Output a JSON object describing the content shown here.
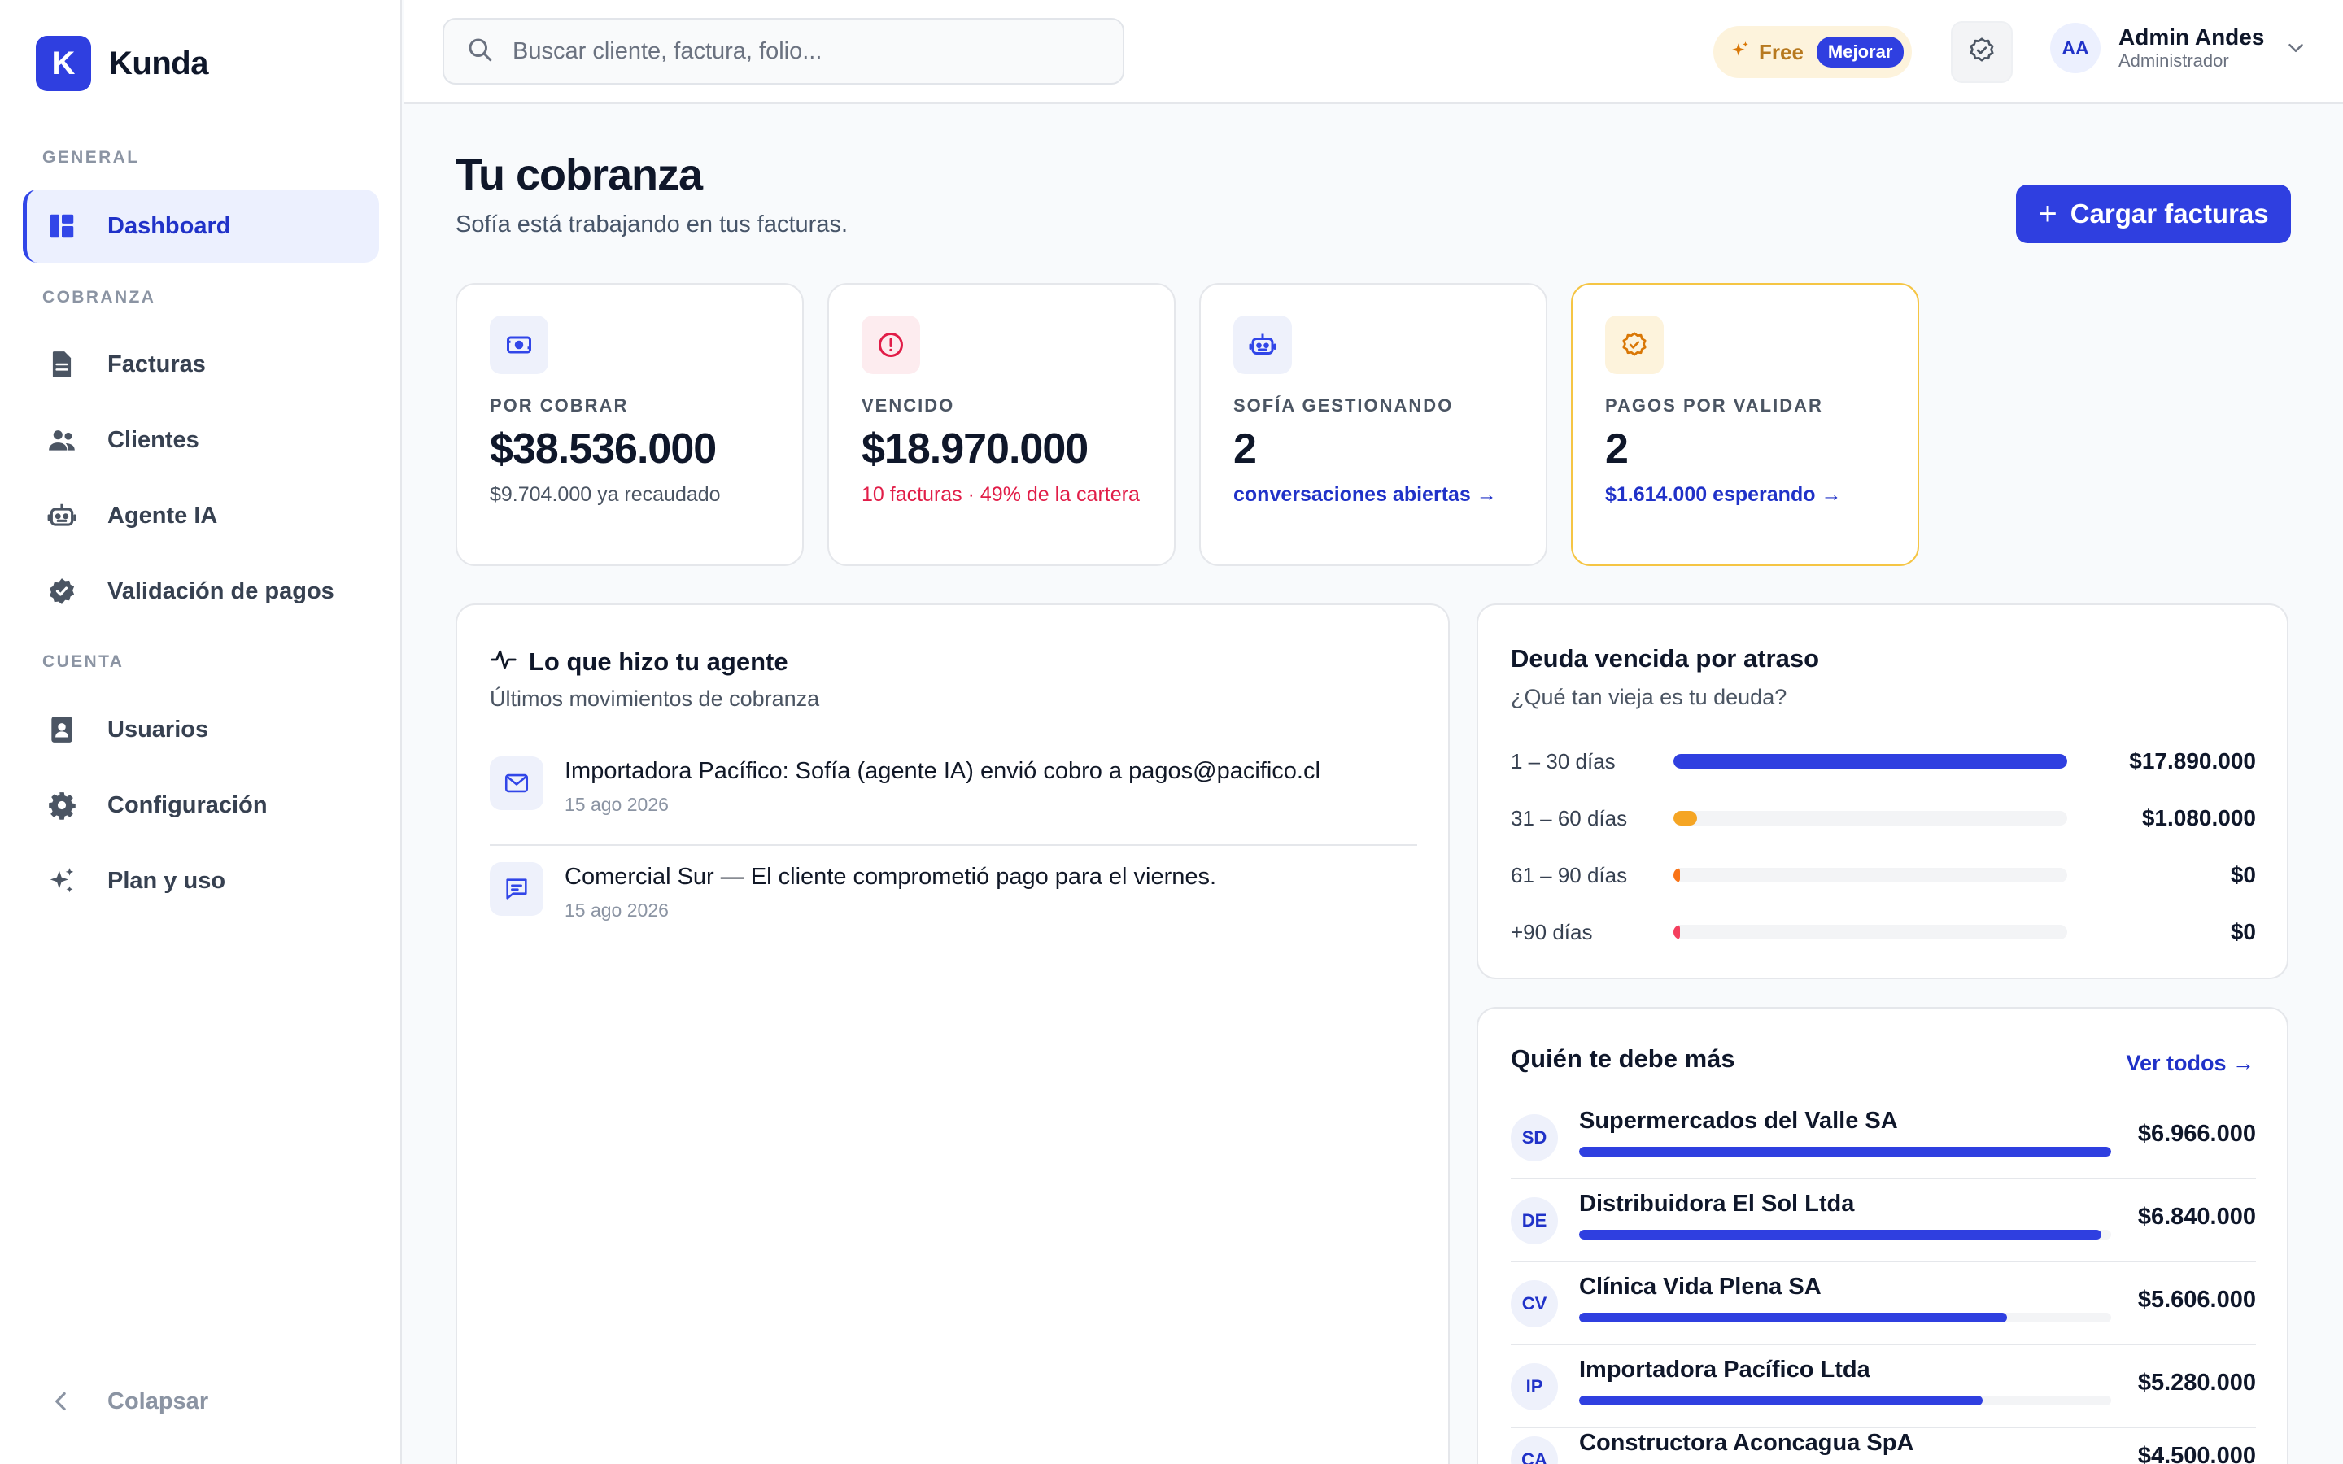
{
  "app": {
    "logo_letter": "K",
    "name": "Kunda"
  },
  "sidebar": {
    "sections": [
      {
        "label": "GENERAL",
        "items": [
          {
            "label": "Dashboard",
            "icon": "dashboard-icon",
            "active": true
          }
        ]
      },
      {
        "label": "COBRANZA",
        "items": [
          {
            "label": "Facturas",
            "icon": "document-icon"
          },
          {
            "label": "Clientes",
            "icon": "users-icon"
          },
          {
            "label": "Agente IA",
            "icon": "robot-icon"
          },
          {
            "label": "Validación de pagos",
            "icon": "badge-check-icon"
          }
        ]
      },
      {
        "label": "CUENTA",
        "items": [
          {
            "label": "Usuarios",
            "icon": "id-card-icon"
          },
          {
            "label": "Configuración",
            "icon": "gear-icon"
          },
          {
            "label": "Plan y uso",
            "icon": "sparkles-icon"
          }
        ]
      }
    ],
    "collapse_label": "Colapsar"
  },
  "topbar": {
    "search_placeholder": "Buscar cliente, factura, folio...",
    "plan_label": "Free",
    "upgrade_label": "Mejorar",
    "user": {
      "initials": "AA",
      "name": "Admin Andes",
      "role": "Administrador"
    }
  },
  "header": {
    "title": "Tu cobranza",
    "subtitle": "Sofía está trabajando en tus facturas.",
    "primary_action": "Cargar facturas"
  },
  "kpis": [
    {
      "label": "POR COBRAR",
      "value": "$38.536.000",
      "sub": "$9.704.000 ya recaudado",
      "icon": "cash-icon",
      "tone": "neutral",
      "icon_color": "#3146e8",
      "icon_bg": "#eef1fb"
    },
    {
      "label": "VENCIDO",
      "value": "$18.970.000",
      "sub": "10 facturas · 49% de la cartera",
      "icon": "alert-circle-icon",
      "tone": "red",
      "icon_color": "#e11d48",
      "icon_bg": "#fdecef"
    },
    {
      "label": "SOFÍA GESTIONANDO",
      "value": "2",
      "sub": "conversaciones abiertas →",
      "icon": "robot-icon",
      "tone": "link",
      "icon_color": "#3146e8",
      "icon_bg": "#eef1fb"
    },
    {
      "label": "PAGOS POR VALIDAR",
      "value": "2",
      "sub": "$1.614.000 esperando →",
      "icon": "badge-check-icon",
      "tone": "link",
      "icon_color": "#d97706",
      "icon_bg": "#fdf3dc",
      "highlight": true
    }
  ],
  "activity": {
    "title": "Lo que hizo tu agente",
    "subtitle": "Últimos movimientos de cobranza",
    "items": [
      {
        "icon": "mail-icon",
        "text": "Importadora Pacífico: Sofía (agente IA) envió cobro a pagos@pacifico.cl",
        "date": "15 ago 2026"
      },
      {
        "icon": "chat-icon",
        "text": "Comercial Sur — El cliente comprometió pago para el viernes.",
        "date": "15 ago 2026"
      }
    ]
  },
  "aging": {
    "title": "Deuda vencida por atraso",
    "subtitle": "¿Qué tan vieja es tu deuda?",
    "rows": [
      {
        "label": "1 – 30 días",
        "amount": "$17.890.000",
        "fraction": 1.0,
        "color": "#2f3fe0"
      },
      {
        "label": "31 – 60 días",
        "amount": "$1.080.000",
        "fraction": 0.06,
        "color": "#f5a524"
      },
      {
        "label": "61 – 90 días",
        "amount": "$0",
        "fraction": 0.0,
        "color": "#f97316"
      },
      {
        "label": "+90 días",
        "amount": "$0",
        "fraction": 0.0,
        "color": "#f43f5e"
      }
    ]
  },
  "top_debtors": {
    "title": "Quién te debe más",
    "see_all": "Ver todos →",
    "items": [
      {
        "initials": "SD",
        "name": "Supermercados del Valle SA",
        "amount": "$6.966.000",
        "fraction": 1.0
      },
      {
        "initials": "DE",
        "name": "Distribuidora El Sol Ltda",
        "amount": "$6.840.000",
        "fraction": 0.982
      },
      {
        "initials": "CV",
        "name": "Clínica Vida Plena SA",
        "amount": "$5.606.000",
        "fraction": 0.805
      },
      {
        "initials": "IP",
        "name": "Importadora Pacífico Ltda",
        "amount": "$5.280.000",
        "fraction": 0.758
      },
      {
        "initials": "CA",
        "name": "Constructora Aconcagua SpA",
        "amount": "$4.500.000",
        "fraction": 0.646
      }
    ]
  }
}
